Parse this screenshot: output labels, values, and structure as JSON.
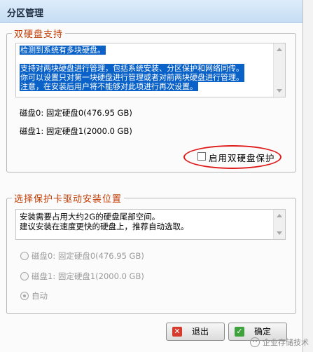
{
  "window": {
    "title": "分区管理"
  },
  "dual_disk": {
    "legend": "双硬盘支持",
    "info_lines": [
      "检测到系统有多块硬盘。",
      "",
      "支持对两块硬盘进行管理，包括系统安装、分区保护和网络同传。",
      "你可以设置只对第一块硬盘进行管理或者对前两块硬盘进行管理。",
      "注意，在安装后用户将不能够对此项进行再次设置。"
    ],
    "disk0": "磁盘0: 固定硬盘0(476.95 GB)",
    "disk1": "磁盘1: 固定硬盘1(2000.0 GB)",
    "enable_checkbox_label": "启用双硬盘保护",
    "enable_checked": false
  },
  "driver_install": {
    "legend": "选择保护卡驱动安装位置",
    "info_lines": [
      "安装需要占用大约2G的硬盘尾部空间。",
      "建议安装在速度更快的硬盘上，推荐自动选取。"
    ],
    "options": [
      {
        "label": "磁盘0: 固定硬盘0(476.95 GB)",
        "selected": false
      },
      {
        "label": "磁盘1: 固定硬盘1(2000.0 GB)",
        "selected": false
      },
      {
        "label": "自动",
        "selected": true
      }
    ]
  },
  "buttons": {
    "exit": "退出",
    "confirm": "确定"
  },
  "watermark": {
    "text": "企业存储技术"
  },
  "colors": {
    "legend": "#c03a00",
    "selection": "#0a62c9",
    "highlight_ring": "#e01b1b"
  }
}
